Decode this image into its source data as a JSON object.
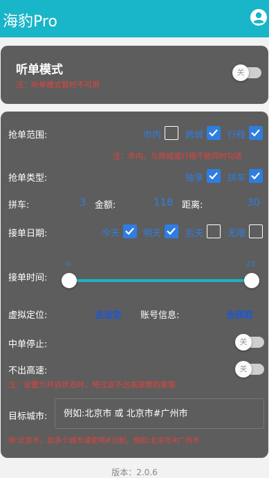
{
  "app": {
    "title": "海豹Pro",
    "accent": "#19b5c8"
  },
  "listen_card": {
    "title": "听单模式",
    "note": "注：听单模式暂时不可用",
    "toggle": {
      "label": "关",
      "on": false
    }
  },
  "range": {
    "label": "抢单范围:",
    "options": [
      {
        "label": "市内",
        "checked": false
      },
      {
        "label": "跨城",
        "checked": true
      },
      {
        "label": "行程",
        "checked": true
      }
    ],
    "note": "注：市内、与跨城或行程不能同时勾选"
  },
  "type": {
    "label": "抢单类型:",
    "options": [
      {
        "label": "独享",
        "checked": true
      },
      {
        "label": "拼车",
        "checked": true
      }
    ]
  },
  "carpool": {
    "label": "拼车:",
    "value": "3",
    "amount_label": "金额:",
    "amount_value": "118",
    "distance_label": "距离:",
    "distance_value": "30"
  },
  "date": {
    "label": "接单日期:",
    "options": [
      {
        "label": "今天",
        "checked": true
      },
      {
        "label": "明天",
        "checked": true
      },
      {
        "label": "后天",
        "checked": false
      },
      {
        "label": "无限",
        "checked": false
      }
    ]
  },
  "time": {
    "label": "接单时间:",
    "min_label": "0",
    "max_label": "23",
    "start": 0,
    "end": 23
  },
  "location": {
    "label": "虚拟定位:",
    "action": "去设定"
  },
  "account": {
    "label": "账号信息:",
    "action": "去获取"
  },
  "midstop": {
    "label": "中单停止:",
    "toggle_label": "关",
    "on": false
  },
  "highway": {
    "label": "不出高速:",
    "toggle_label": "关",
    "on": false,
    "note": "注：设置为开启状态时，将过滤不出高速费的乘客"
  },
  "target_city": {
    "label": "目标城市:",
    "placeholder": "例如:北京市 或 北京市#广州市",
    "note": "例:北京市，如多个城市请使用#分割，例如:北京市#广州市"
  },
  "footer": {
    "version": "版本：2.0.6"
  }
}
